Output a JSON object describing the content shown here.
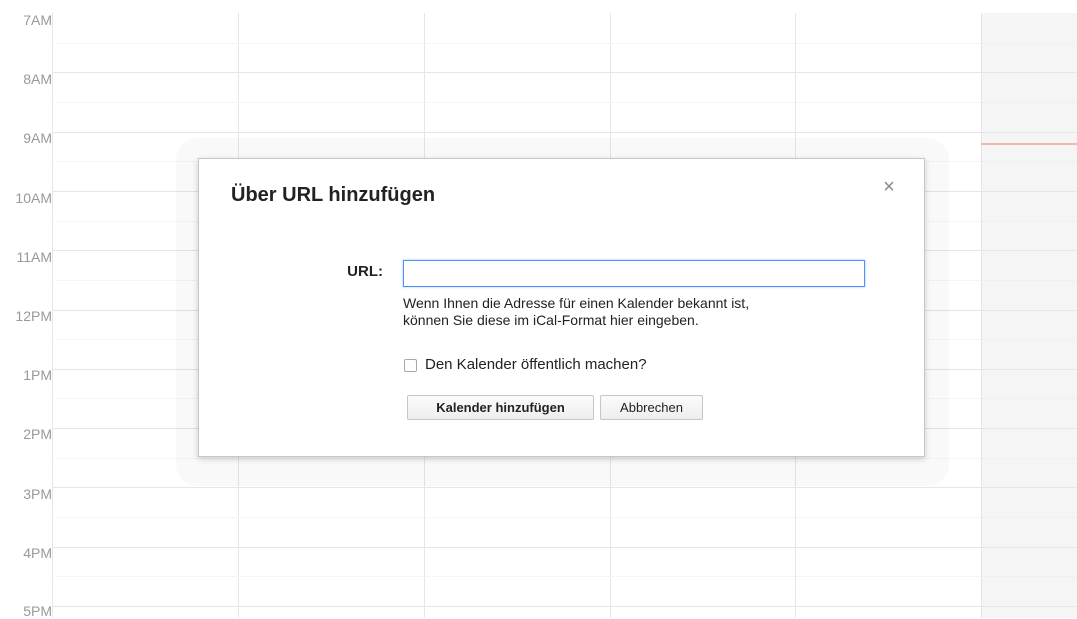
{
  "calendar": {
    "hours": [
      "7AM",
      "8AM",
      "9AM",
      "10AM",
      "11AM",
      "12PM",
      "1PM",
      "2PM",
      "3PM",
      "4PM",
      "5PM"
    ]
  },
  "dialog": {
    "title": "Über URL hinzufügen",
    "close_glyph": "×",
    "url_label": "URL:",
    "url_value": "",
    "help_line_1": "Wenn Ihnen die Adresse für einen Kalender bekannt ist,",
    "help_line_2": "können Sie diese im iCal-Format hier eingeben.",
    "public_checkbox_label": "Den Kalender öffentlich machen?",
    "public_checked": false,
    "add_button_label": "Kalender hinzufügen",
    "cancel_button_label": "Abbrechen"
  },
  "colors": {
    "accent_focus": "#4d90fe",
    "now_indicator": "#f4b6b0",
    "today_column": "#f5f5f5"
  }
}
